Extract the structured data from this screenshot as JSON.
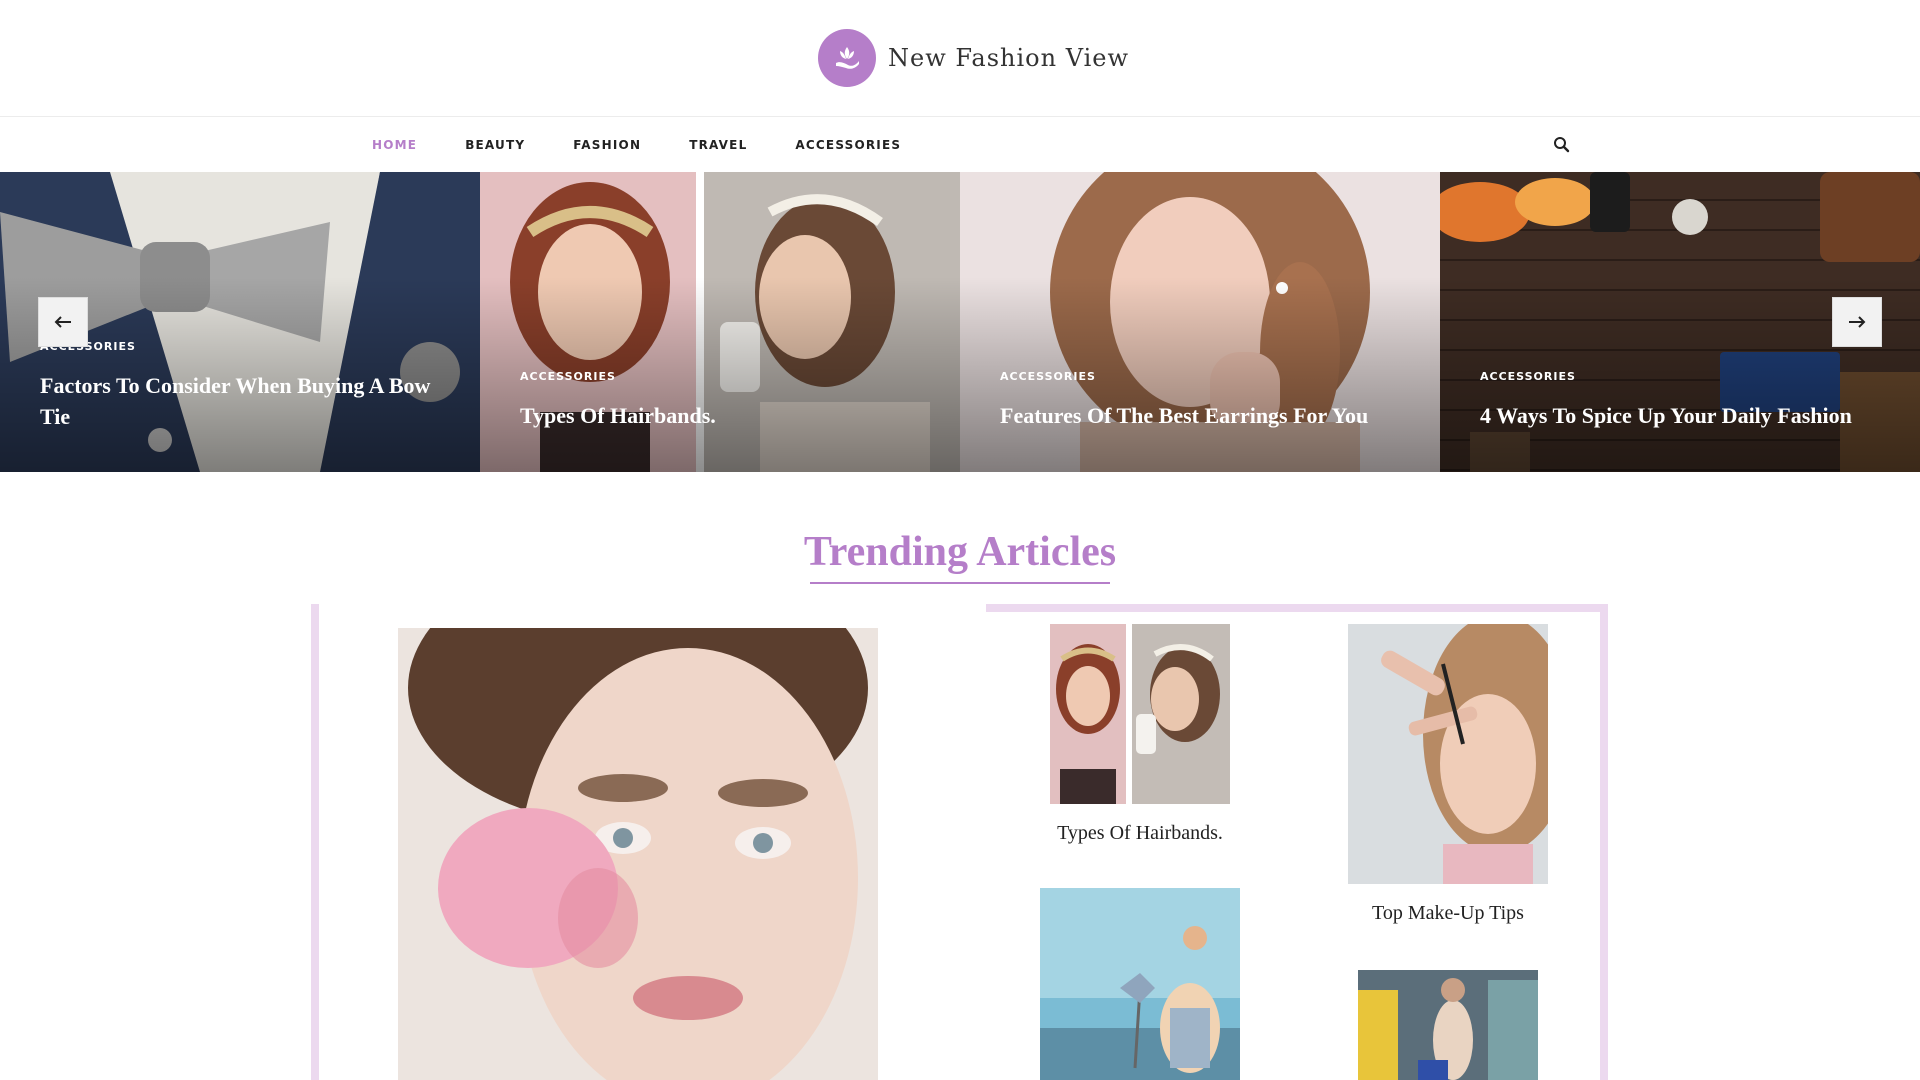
{
  "site": {
    "name": "New Fashion View"
  },
  "nav": {
    "items": [
      {
        "label": "HOME",
        "active": true
      },
      {
        "label": "BEAUTY",
        "active": false
      },
      {
        "label": "FASHION",
        "active": false
      },
      {
        "label": "TRAVEL",
        "active": false
      },
      {
        "label": "ACCESSORIES",
        "active": false
      }
    ]
  },
  "slider": {
    "slides": [
      {
        "category": "ACCESSORIES",
        "title": "Factors To Consider When Buying A Bow Tie"
      },
      {
        "category": "ACCESSORIES",
        "title": "Types Of Hairbands."
      },
      {
        "category": "ACCESSORIES",
        "title": "Features Of The Best Earrings For You"
      },
      {
        "category": "ACCESSORIES",
        "title": "4 Ways To Spice Up Your Daily Fashion"
      }
    ]
  },
  "trending": {
    "title": "Trending Articles",
    "cards": [
      {
        "title": "Types Of Hairbands."
      },
      {
        "title": "Top Make-Up Tips"
      }
    ]
  },
  "colors": {
    "accent": "#b57ec9",
    "frame": "#ecd9ef"
  },
  "icons": {
    "logo": "lotus-hand-icon",
    "search": "search-icon",
    "prev": "arrow-left-icon",
    "next": "arrow-right-icon"
  }
}
